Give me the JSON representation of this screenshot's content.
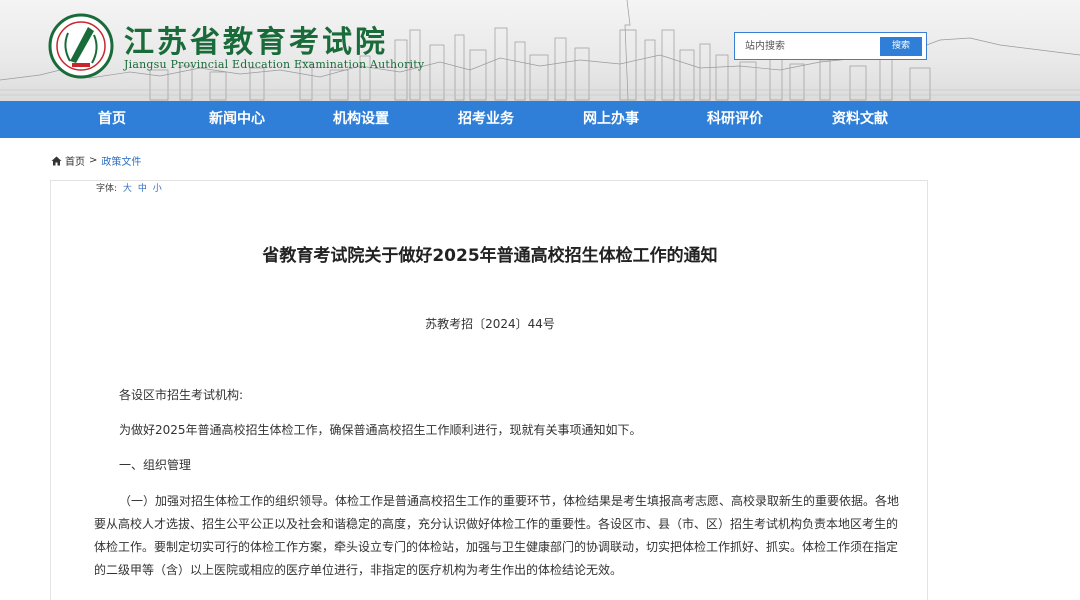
{
  "header": {
    "site_name_cn": "江苏省教育考试院",
    "site_name_en": "Jiangsu Provincial Education Examination Authority",
    "search": {
      "placeholder": "站内搜索",
      "button_label": "搜索"
    }
  },
  "nav": {
    "items": [
      {
        "label": "首页"
      },
      {
        "label": "新闻中心"
      },
      {
        "label": "机构设置"
      },
      {
        "label": "招考业务"
      },
      {
        "label": "网上办事"
      },
      {
        "label": "科研评价"
      },
      {
        "label": "资料文献"
      }
    ]
  },
  "breadcrumb": {
    "home": "首页",
    "separator": ">",
    "current": "政策文件"
  },
  "article": {
    "font_size_label": "字体:",
    "font_sizes": [
      "大",
      "中",
      "小"
    ],
    "title": "省教育考试院关于做好2025年普通高校招生体检工作的通知",
    "doc_number": "苏教考招〔2024〕44号",
    "salutation": "各设区市招生考试机构:",
    "intro": "为做好2025年普通高校招生体检工作，确保普通高校招生工作顺利进行，现就有关事项通知如下。",
    "section_1": "一、组织管理",
    "para_1_lines": [
      "（一）加强对招生体检工作的组织领导。体检工作是普通高校招生工作的重要环节，体检结果是考生填报高考志愿、高校录取新生的重要依据。各地",
      "要从高校人才选拔、招生公平公正以及社会和谐稳定的高度，充分认识做好体检工作的重要性。各设区市、县（市、区）招生考试机构负责本地区考生的",
      "体检工作。要制定切实可行的体检工作方案，牵头设立专门的体检站，加强与卫生健康部门的协调联动，切实把体检工作抓好、抓实。体检工作须在指定",
      "的二级甲等（含）以上医院或相应的医疗单位进行，非指定的医疗机构为考生作出的体检结论无效。"
    ]
  },
  "colors": {
    "nav_bg": "#2f7fd8",
    "brand_green": "#1a6b3a",
    "link_blue": "#2f6fc4"
  }
}
